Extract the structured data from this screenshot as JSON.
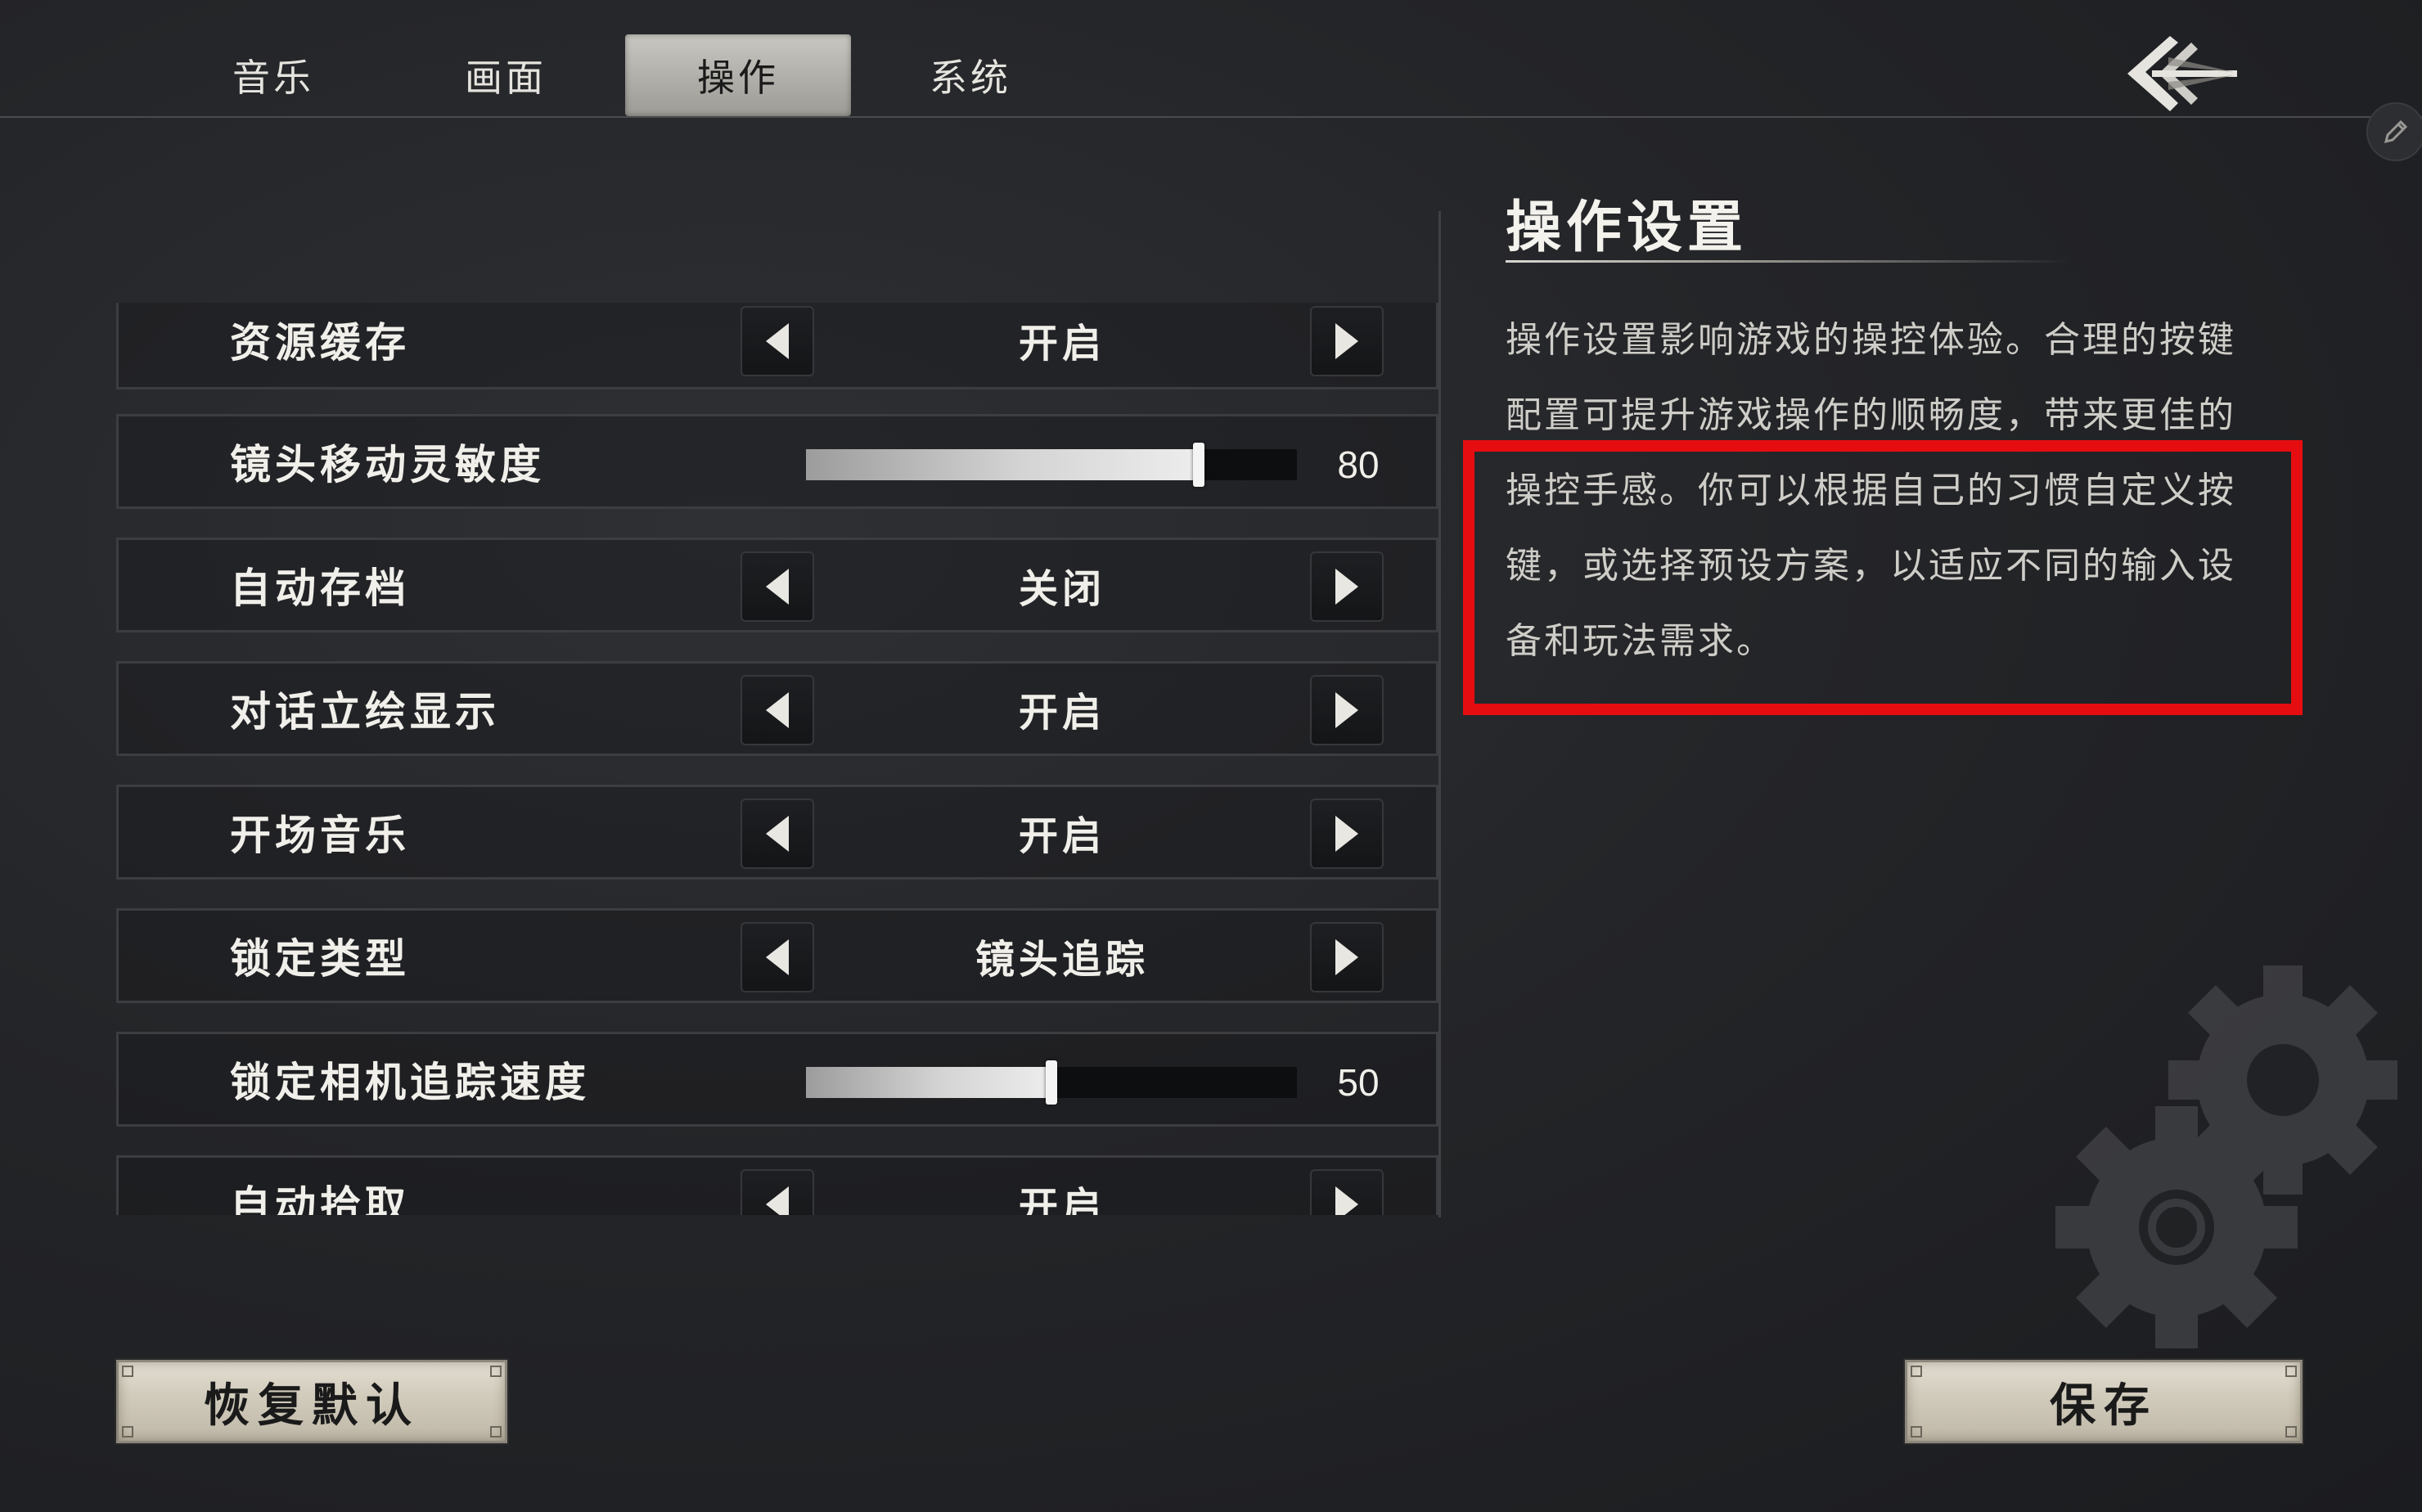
{
  "tabs": [
    {
      "label": "音乐",
      "active": false
    },
    {
      "label": "画面",
      "active": false
    },
    {
      "label": "操作",
      "active": true
    },
    {
      "label": "系统",
      "active": false
    }
  ],
  "settings": [
    {
      "label": "资源缓存",
      "type": "toggle",
      "value": "开启"
    },
    {
      "label": "镜头移动灵敏度",
      "type": "slider",
      "value": "80",
      "level": 80
    },
    {
      "label": "自动存档",
      "type": "toggle",
      "value": "关闭"
    },
    {
      "label": "对话立绘显示",
      "type": "toggle",
      "value": "开启"
    },
    {
      "label": "开场音乐",
      "type": "toggle",
      "value": "开启"
    },
    {
      "label": "锁定类型",
      "type": "toggle",
      "value": "镜头追踪"
    },
    {
      "label": "锁定相机追踪速度",
      "type": "slider",
      "value": "50",
      "level": 50
    },
    {
      "label": "自动拾取",
      "type": "toggle",
      "value": "开启"
    }
  ],
  "description": {
    "title": "操作设置",
    "lines": [
      "操作设置影响游戏的操控体验。合理的按键",
      "配置可提升游戏操作的顺畅度，带来更佳的",
      "操控手感。你可以根据自己的习惯自定义按",
      "键，或选择预设方案，以适应不同的输入设",
      "备和玩法需求。"
    ]
  },
  "buttons": {
    "reset": "恢复默认",
    "save": "保存"
  },
  "colors": {
    "highlight": "#e60d10",
    "active_tab": "#bcbab4"
  },
  "icons": {
    "back": "back-arrow-icon",
    "edit": "pencil-icon",
    "decoration": "gear-icon"
  }
}
